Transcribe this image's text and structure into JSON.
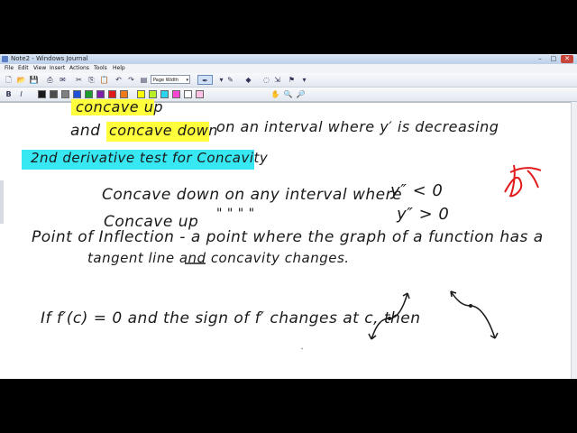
{
  "window": {
    "title": "Note2 - Windows Journal",
    "min": "–",
    "max": "□",
    "close": "✕"
  },
  "menu": [
    "File",
    "Edit",
    "View",
    "Insert",
    "Actions",
    "Tools",
    "Help"
  ],
  "toolbar": {
    "page_width": "Page Width",
    "colors": [
      "#1a1a1a",
      "#4d4d4d",
      "#808080",
      "#1f4fd8",
      "#1c9b2e",
      "#7d1fa8",
      "#e01b1b",
      "#f07a1a",
      "#ffff00",
      "#b7ee2a",
      "#2ad4ee",
      "#ff45d4",
      "#ffffff",
      "#ffc0e6"
    ]
  },
  "note": {
    "line1": "concave up",
    "line2a": "and",
    "line2b": "concave down",
    "line2c": "on an interval where y′ is decreasing",
    "heading": "2nd derivative test for Concavity",
    "row1a": "Concave down on any interval where",
    "row1b": "y″ < 0",
    "row2a": "Concave up",
    "row2b": "\"      \"      \"      \"",
    "row2c": "y″ > 0",
    "poi1": "Point of Inflection - a point where the graph of a function has a",
    "poi2": "tangent line and concavity changes.",
    "ifline": "If f′(c) = 0 and the sign of f′ changes at c, then"
  }
}
